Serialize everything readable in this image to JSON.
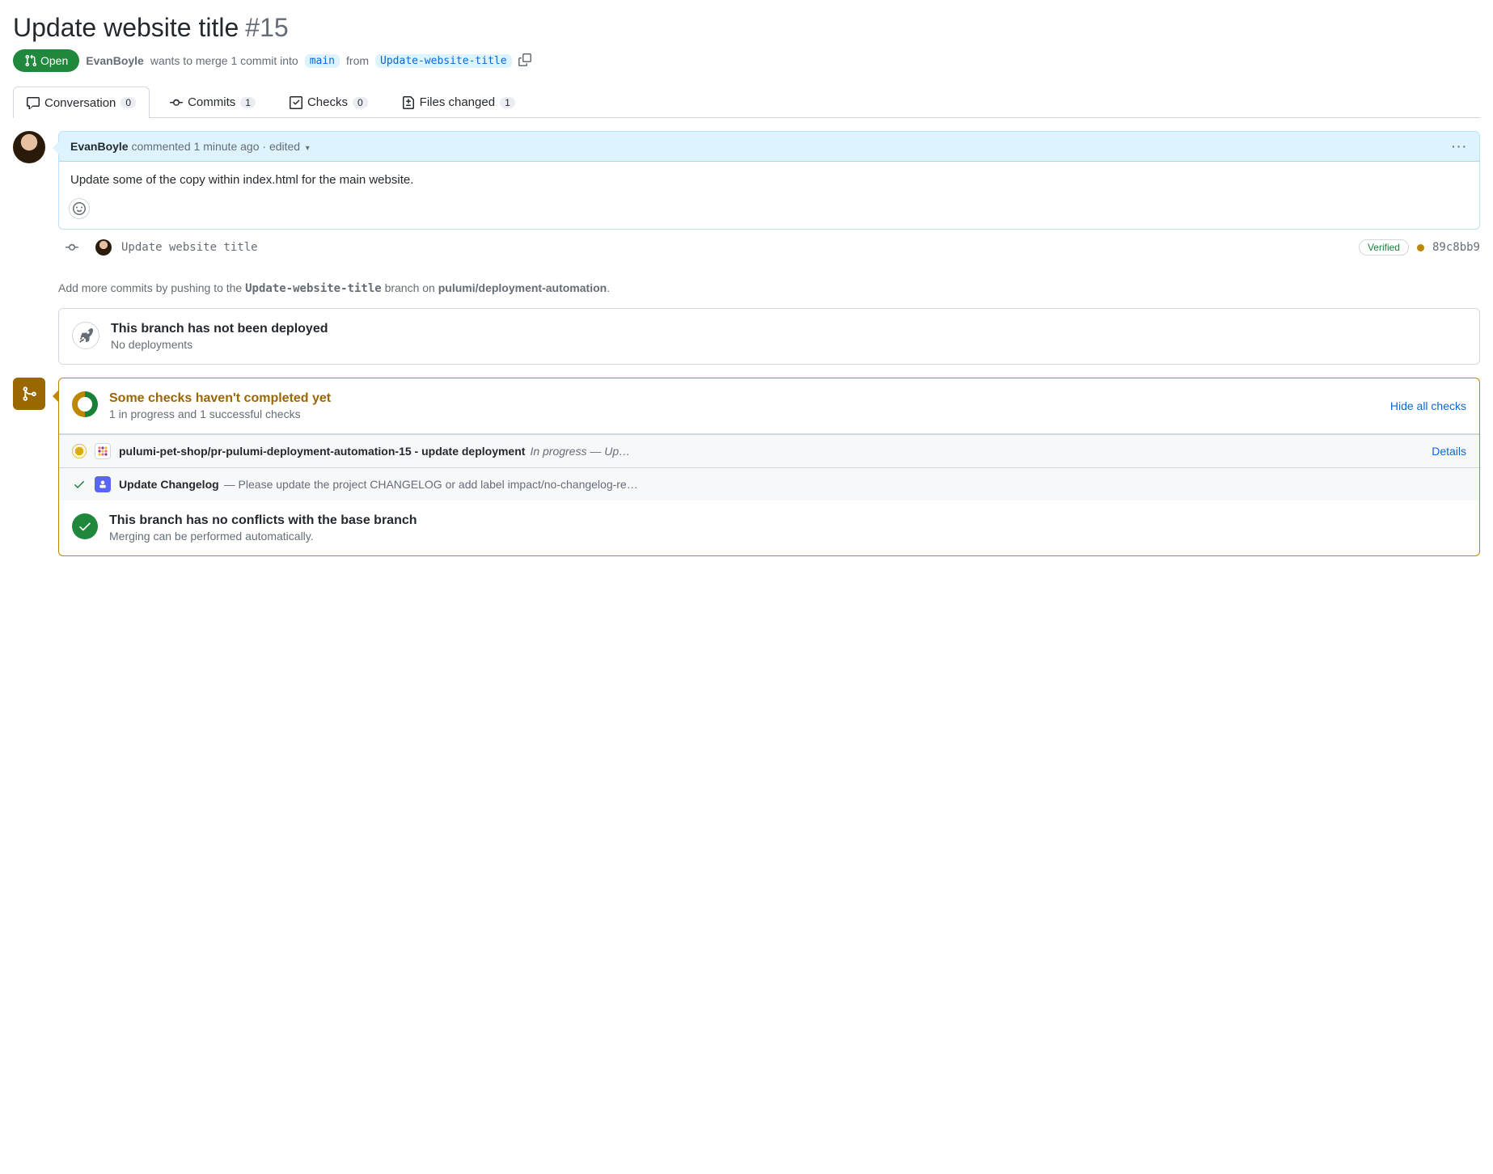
{
  "header": {
    "title": "Update website title",
    "number": "#15",
    "state": "Open",
    "author": "EvanBoyle",
    "merge_text_1": "wants to merge 1 commit into",
    "base_branch": "main",
    "merge_text_2": "from",
    "head_branch": "Update-website-title"
  },
  "tabs": {
    "conversation": {
      "label": "Conversation",
      "count": "0"
    },
    "commits": {
      "label": "Commits",
      "count": "1"
    },
    "checks": {
      "label": "Checks",
      "count": "0"
    },
    "files": {
      "label": "Files changed",
      "count": "1"
    }
  },
  "comment": {
    "author": "EvanBoyle",
    "action": "commented",
    "time": "1 minute ago",
    "edited": "edited",
    "body": "Update some of the copy within index.html for the main website."
  },
  "commit_event": {
    "message": "Update website title",
    "verified": "Verified",
    "sha": "89c8bb9"
  },
  "push_hint": {
    "prefix": "Add more commits by pushing to the ",
    "branch": "Update-website-title",
    "mid": " branch on ",
    "repo": "pulumi/deployment-automation",
    "suffix": "."
  },
  "deploy": {
    "title": "This branch has not been deployed",
    "sub": "No deployments"
  },
  "checks": {
    "title": "Some checks haven't completed yet",
    "sub": "1 in progress and 1 successful checks",
    "hide": "Hide all checks",
    "items": [
      {
        "status": "pending",
        "name": "pulumi-pet-shop/pr-pulumi-deployment-automation-15 - update deployment",
        "desc": "In progress — Up…",
        "link": "Details"
      },
      {
        "status": "success",
        "name": "Update Changelog",
        "desc": "— Please update the project CHANGELOG or add label impact/no-changelog-re…",
        "link": ""
      }
    ]
  },
  "conflicts": {
    "title": "This branch has no conflicts with the base branch",
    "sub": "Merging can be performed automatically."
  }
}
